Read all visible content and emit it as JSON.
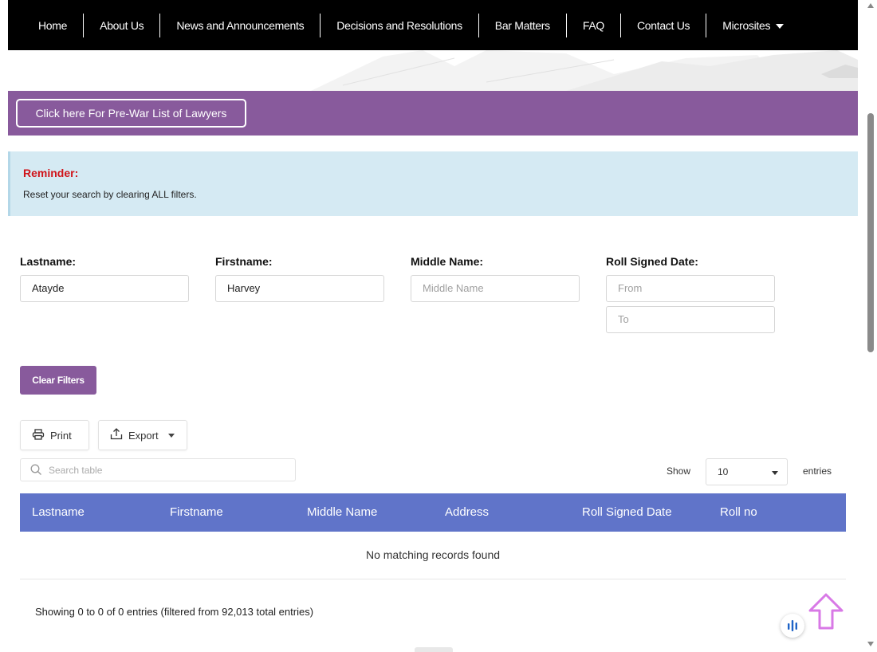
{
  "nav": {
    "items": [
      "Home",
      "About Us",
      "News and Announcements",
      "Decisions and Resolutions",
      "Bar Matters",
      "FAQ",
      "Contact Us",
      "Microsites"
    ]
  },
  "prewar_button": "Click here For Pre-War List of Lawyers",
  "reminder": {
    "title": "Reminder:",
    "text": "Reset your search by clearing ALL filters."
  },
  "filters": {
    "lastname": {
      "label": "Lastname:",
      "value": "Atayde"
    },
    "firstname": {
      "label": "Firstname:",
      "value": "Harvey"
    },
    "middlename": {
      "label": "Middle Name:",
      "placeholder": "Middle Name"
    },
    "roll_date": {
      "label": "Roll Signed Date:",
      "from_placeholder": "From",
      "to_placeholder": "To"
    }
  },
  "clear_filters": "Clear Filters",
  "toolbar": {
    "print": "Print",
    "export": "Export"
  },
  "search": {
    "placeholder": "Search table"
  },
  "length": {
    "show": "Show",
    "value": "10",
    "entries": "entries"
  },
  "table": {
    "columns": [
      "Lastname",
      "Firstname",
      "Middle Name",
      "Address",
      "Roll Signed Date",
      "Roll no"
    ],
    "empty": "No matching records found"
  },
  "info": "Showing 0 to 0 of 0 entries (filtered from 92,013 total entries)",
  "colors": {
    "nav_bg": "#000000",
    "purple": "#885a9c",
    "reminder_bg": "#d5eaf3",
    "reminder_title": "#d0141a",
    "table_head": "#6074c9"
  }
}
